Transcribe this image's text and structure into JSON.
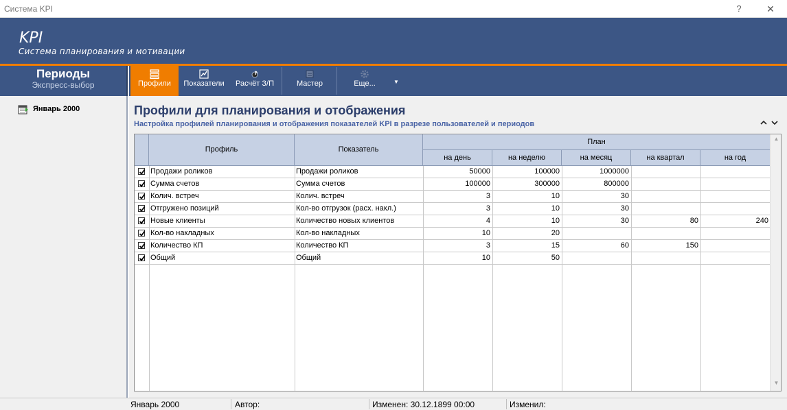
{
  "window": {
    "title": "Система KPI",
    "help_label": "?",
    "close_label": "✕"
  },
  "banner": {
    "title": "KPI",
    "subtitle": "Система планирования и мотивации"
  },
  "periods": {
    "title": "Периоды",
    "subtitle": "Экспресс-выбор",
    "items": [
      {
        "label": "Январь 2000"
      }
    ]
  },
  "toolbar": {
    "buttons": [
      {
        "label": "Профили",
        "icon": "profiles-icon"
      },
      {
        "label": "Показатели",
        "icon": "indicators-icon"
      },
      {
        "label": "Расчёт З/П",
        "icon": "salary-calc-icon"
      },
      {
        "label": "Мастер",
        "icon": "wizard-icon"
      },
      {
        "label": "Еще...",
        "icon": "gear-icon"
      }
    ],
    "dropdown_arrow": "▼"
  },
  "main": {
    "title": "Профили для планирования и отображения",
    "subtitle": "Настройка профилей планирования и отображения показателей KPI в разрезе пользователей и периодов",
    "collapse_up": "⌃",
    "collapse_down": "⌄"
  },
  "grid": {
    "headers": {
      "profile": "Профиль",
      "indicator": "Показатель",
      "plan": "План",
      "day": "на день",
      "week": "на неделю",
      "month": "на месяц",
      "quarter": "на квартал",
      "year": "на год"
    },
    "rows": [
      {
        "checked": true,
        "profile": "Продажи роликов",
        "indicator": "Продажи роликов",
        "day": "50000",
        "week": "100000",
        "month": "1000000",
        "quarter": "",
        "year": ""
      },
      {
        "checked": true,
        "profile": "Сумма счетов",
        "indicator": "Сумма счетов",
        "day": "100000",
        "week": "300000",
        "month": "800000",
        "quarter": "",
        "year": ""
      },
      {
        "checked": true,
        "profile": "Колич. встреч",
        "indicator": "Колич. встреч",
        "day": "3",
        "week": "10",
        "month": "30",
        "quarter": "",
        "year": ""
      },
      {
        "checked": true,
        "profile": "Отгружено позиций",
        "indicator": "Кол-во отгрузок (расх. накл.)",
        "day": "3",
        "week": "10",
        "month": "30",
        "quarter": "",
        "year": ""
      },
      {
        "checked": true,
        "profile": "Новые клиенты",
        "indicator": "Количество новых клиентов",
        "day": "4",
        "week": "10",
        "month": "30",
        "quarter": "80",
        "year": "240"
      },
      {
        "checked": true,
        "profile": "Кол-во накладных",
        "indicator": "Кол-во накладных",
        "day": "10",
        "week": "20",
        "month": "",
        "quarter": "",
        "year": ""
      },
      {
        "checked": true,
        "profile": "Количество КП",
        "indicator": "Количество КП",
        "day": "3",
        "week": "15",
        "month": "60",
        "quarter": "150",
        "year": ""
      },
      {
        "checked": true,
        "profile": "Общий",
        "indicator": "Общий",
        "day": "10",
        "week": "50",
        "month": "",
        "quarter": "",
        "year": ""
      }
    ]
  },
  "statusbar": {
    "period": "Январь 2000",
    "author": "Автор:",
    "modified": "Изменен: 30.12.1899 00:00",
    "modified_by": "Изменил:"
  },
  "colors": {
    "banner": "#3c5685",
    "accent": "#f07d00",
    "grid_header": "#c6d1e4",
    "title": "#2c3e6b"
  }
}
